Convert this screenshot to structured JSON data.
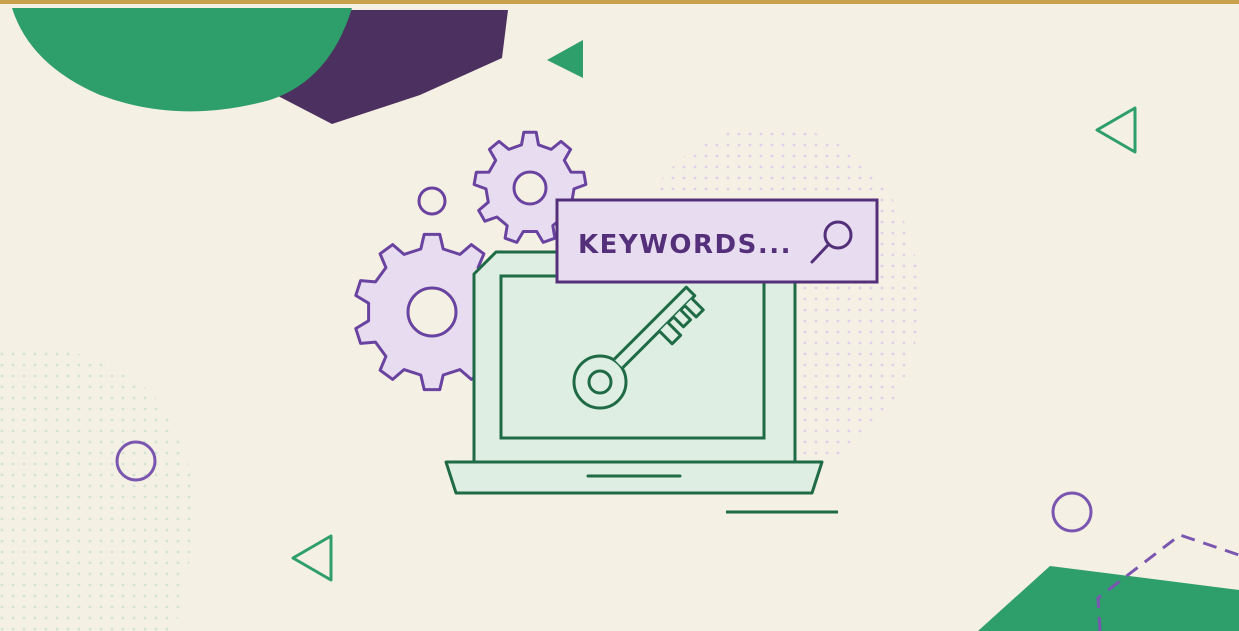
{
  "search_box": {
    "text": "KEYWORDS...",
    "icon": "magnifier-icon"
  },
  "screen_icon": "key-icon",
  "decorations": [
    "gear-icon",
    "circle-outline",
    "triangle-outline",
    "triangle-solid",
    "dot-pattern",
    "hexagon-shape"
  ],
  "colors": {
    "background": "#f5f0e4",
    "top_border": "#c9a14a",
    "green_dark": "#1f6b46",
    "green_bright": "#2e9e6a",
    "green_light": "#dfeee2",
    "purple_dark": "#4c3160",
    "purple": "#7a56b0",
    "purple_light": "#e8ddf0",
    "text_purple": "#55307a"
  }
}
